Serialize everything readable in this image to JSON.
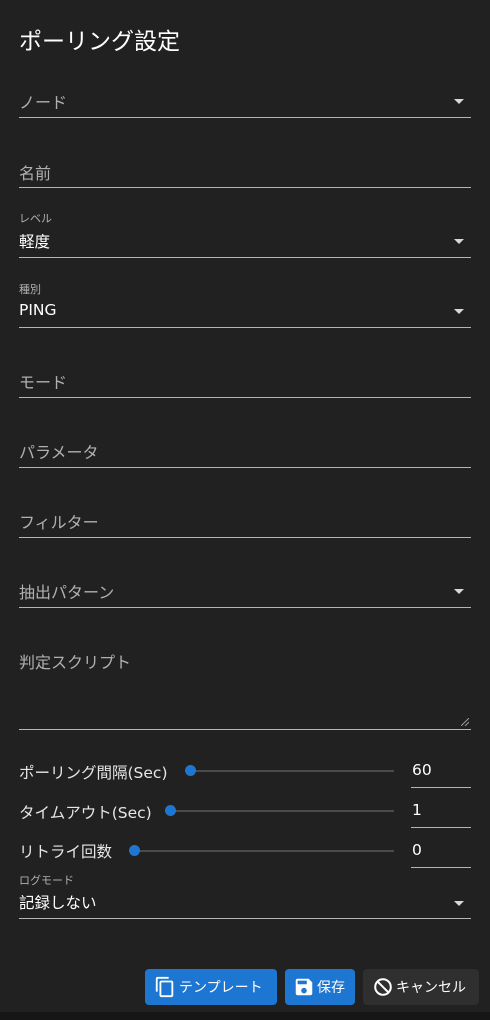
{
  "dialog": {
    "title": "ポーリング設定"
  },
  "fields": {
    "node": {
      "placeholder": "ノード"
    },
    "name": {
      "placeholder": "名前"
    },
    "level": {
      "label": "レベル",
      "value": "軽度"
    },
    "type": {
      "label": "種別",
      "value": "PING"
    },
    "mode": {
      "placeholder": "モード"
    },
    "params": {
      "placeholder": "パラメータ"
    },
    "filter": {
      "placeholder": "フィルター"
    },
    "extract_pattern": {
      "placeholder": "抽出パターン"
    },
    "script": {
      "placeholder": "判定スクリプト"
    },
    "log_mode": {
      "label": "ログモード",
      "value": "記録しない"
    }
  },
  "sliders": {
    "interval": {
      "label": "ポーリング間隔(Sec)",
      "value": "60"
    },
    "timeout": {
      "label": "タイムアウト(Sec)",
      "value": "1"
    },
    "retry": {
      "label": "リトライ回数",
      "value": "0"
    }
  },
  "buttons": {
    "template": "テンプレート",
    "save": "保存",
    "cancel": "キャンセル"
  },
  "colors": {
    "accent": "#1e76d3",
    "background": "#212121"
  },
  "icons": {
    "template": "copy-icon",
    "save": "floppy-disk-icon",
    "cancel": "block-icon",
    "dropdown": "caret-down-icon"
  }
}
